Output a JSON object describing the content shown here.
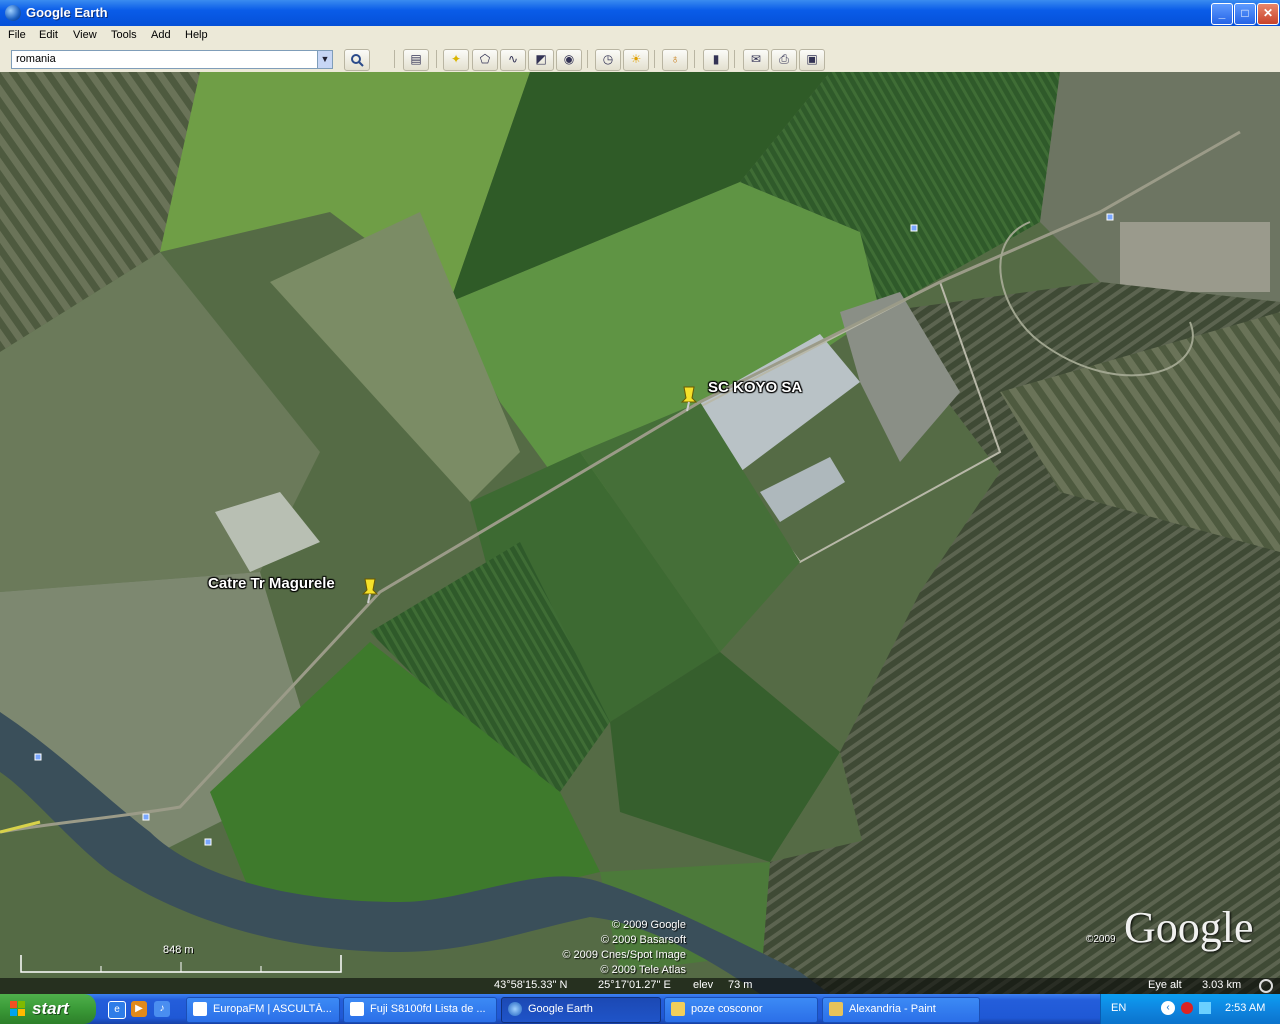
{
  "window": {
    "title": "Google Earth",
    "minimize": "_",
    "maximize": "□",
    "close": "✕"
  },
  "menu": [
    "File",
    "Edit",
    "View",
    "Tools",
    "Add",
    "Help"
  ],
  "search": {
    "value": "romania",
    "button_icon": "magnifier-icon"
  },
  "toolbar_icons": [
    "sidebar-icon",
    "placemark-icon",
    "polygon-icon",
    "path-icon",
    "image-overlay-icon",
    "record-tour-icon",
    "historical-imagery-icon",
    "sunlight-icon",
    "planets-icon",
    "ruler-icon",
    "email-icon",
    "print-icon",
    "map-export-icon"
  ],
  "map": {
    "placemarks": [
      {
        "label": "SC KOYO SA",
        "icon": "yellow-pushpin-icon"
      },
      {
        "label": "Catre Tr Magurele",
        "icon": "yellow-pushpin-icon"
      }
    ],
    "credits": [
      "© 2009 Google",
      "© 2009 Basarsoft",
      "© 2009 Cnes/Spot Image",
      "© 2009 Tele Atlas"
    ],
    "logo_year": "©2009",
    "logo_text": "Google",
    "scale": "848 m"
  },
  "status": {
    "lat": "43°58'15.33\" N",
    "lon": "25°17'01.27\" E",
    "elev_label": "elev",
    "elev": "73 m",
    "eye_label": "Eye alt",
    "eye_alt": "3.03 km"
  },
  "taskbar": {
    "start": "start",
    "tasks": [
      {
        "label": "EuropaFM | ASCULTĂ...",
        "active": false
      },
      {
        "label": "Fuji S8100fd Lista de ...",
        "active": false
      },
      {
        "label": "Google Earth",
        "active": true
      },
      {
        "label": "poze cosconor",
        "active": false
      },
      {
        "label": "Alexandria - Paint",
        "active": false
      }
    ],
    "language": "EN",
    "clock": "2:53 AM"
  },
  "colors": {
    "titlebar": "#0a5ce8",
    "taskbar": "#245edb",
    "start": "#3a9a37",
    "tray": "#0f86e0"
  }
}
